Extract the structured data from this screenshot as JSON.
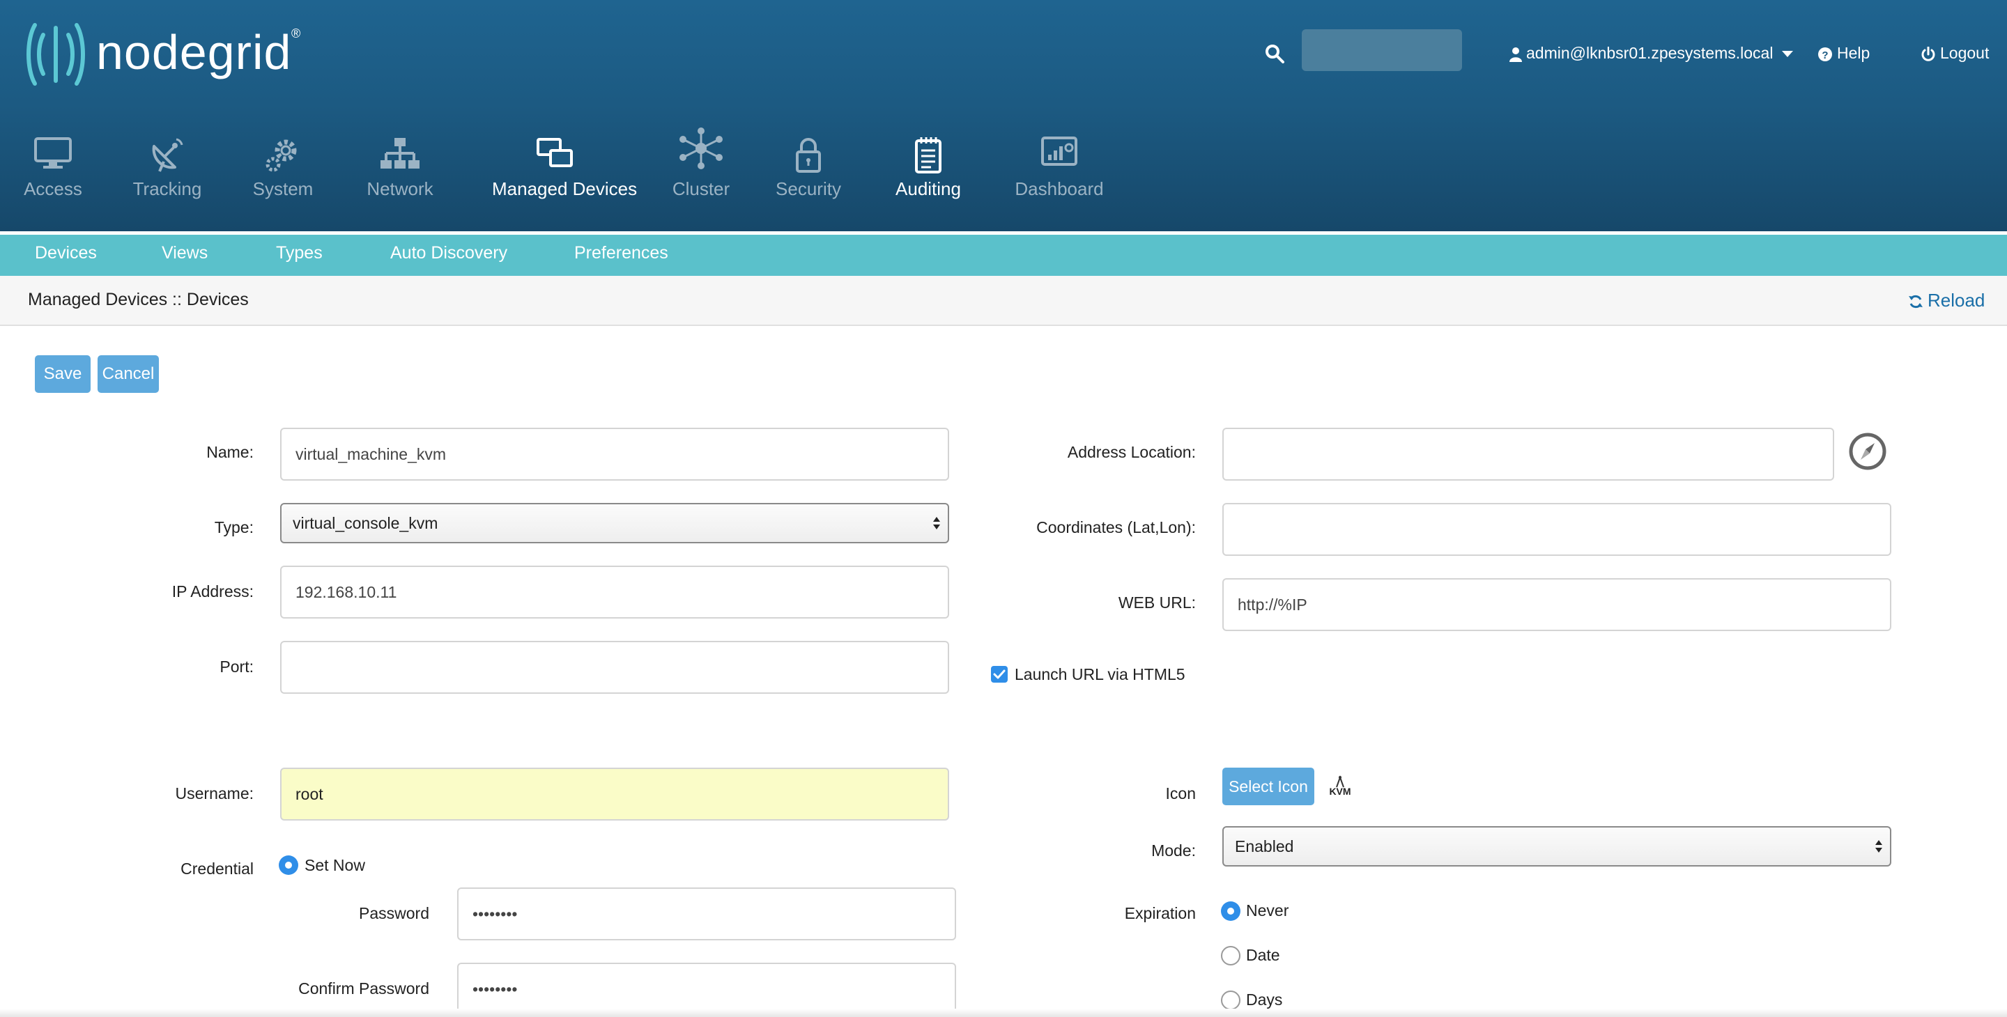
{
  "header": {
    "brand": "nodegrid",
    "brand_mark": "®",
    "user": "admin@lknbsr01.zpesystems.local",
    "help": "Help",
    "logout": "Logout"
  },
  "main_nav": [
    {
      "label": "Access",
      "icon": "monitor-icon",
      "active": false
    },
    {
      "label": "Tracking",
      "icon": "satellite-dish-icon",
      "active": false
    },
    {
      "label": "System",
      "icon": "gears-icon",
      "active": false
    },
    {
      "label": "Network",
      "icon": "network-tree-icon",
      "active": false
    },
    {
      "label": "Managed Devices",
      "icon": "managed-devices-icon",
      "active": true
    },
    {
      "label": "Cluster",
      "icon": "cluster-icon",
      "active": false
    },
    {
      "label": "Security",
      "icon": "lock-icon",
      "active": false
    },
    {
      "label": "Auditing",
      "icon": "notepad-icon",
      "active": true
    },
    {
      "label": "Dashboard",
      "icon": "dashboard-icon",
      "active": false
    }
  ],
  "sub_nav": [
    "Devices",
    "Views",
    "Types",
    "Auto Discovery",
    "Preferences"
  ],
  "breadcrumb": "Managed Devices :: Devices",
  "reload": "Reload",
  "buttons": {
    "save": "Save",
    "cancel": "Cancel",
    "select_icon": "Select Icon"
  },
  "form": {
    "name_label": "Name:",
    "name_value": "virtual_machine_kvm",
    "type_label": "Type:",
    "type_value": "virtual_console_kvm",
    "ip_label": "IP Address:",
    "ip_value": "192.168.10.11",
    "port_label": "Port:",
    "port_value": "",
    "username_label": "Username:",
    "username_value": "root",
    "credential_label": "Credential",
    "set_now_label": "Set Now",
    "password_label": "Password",
    "password_value": "••••••••",
    "confirm_password_label": "Confirm Password",
    "confirm_password_value": "••••••••",
    "address_location_label": "Address Location:",
    "address_location_value": "",
    "coordinates_label": "Coordinates (Lat,Lon):",
    "coordinates_value": "",
    "web_url_label": "WEB URL:",
    "web_url_value": "http://%IP",
    "launch_html5_label": "Launch URL via HTML5",
    "icon_label": "Icon",
    "icon_preview_text": "KVM",
    "mode_label": "Mode:",
    "mode_value": "Enabled",
    "expiration_label": "Expiration",
    "expiration_options": [
      "Never",
      "Date",
      "Days"
    ]
  },
  "colors": {
    "header": "#1c5a82",
    "subnav": "#5ac1cb",
    "button": "#5da9dd",
    "accent": "#2f8ee8",
    "logo": "#5cc8d4"
  }
}
